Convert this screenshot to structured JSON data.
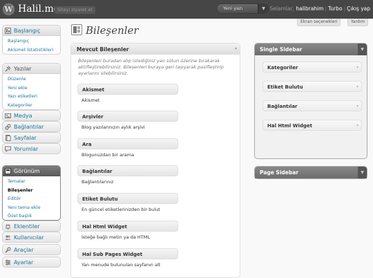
{
  "header": {
    "logo": "W",
    "site_title": "Halil.me",
    "visit_site": "Siteyi ziyaret et",
    "quick_action": "Yeni yazı",
    "greeting": "Selamlar,",
    "username": "halibrahim",
    "turbo": "Turbo",
    "logout": "Çıkış yap"
  },
  "screen_meta": {
    "screen_options": "Ekran seçenekleri",
    "help": "Yardım"
  },
  "menu": {
    "dashboard": {
      "label": "Başlangıç",
      "items": [
        "Başlangıç",
        "Akismet İstatistikleri"
      ]
    },
    "posts": {
      "label": "Yazılar",
      "items": [
        "Düzenle",
        "Yeni ekle",
        "Yazı etiketleri",
        "Kategoriler"
      ]
    },
    "media": "Medya",
    "links": "Bağlantılar",
    "pages": "Sayfalar",
    "comments": "Yorumlar",
    "appearance": {
      "label": "Görünüm",
      "items": [
        "Temalar",
        "Bileşenler",
        "Editör",
        "Yeni tema ekle",
        "Özel başlık"
      ]
    },
    "plugins": "Eklentiler",
    "users": "Kullanıcılar",
    "tools": "Araçlar",
    "settings": "Ayarlar"
  },
  "page_title": "Bileşenler",
  "available": {
    "title": "Mevcut Bileşenler",
    "description": "Bileşenleri buradan alıp istediğiniz yan sütun üzerine bırakarak aktifleştirebilirsiniz. Bileşenleri buraya geri taşıyarak pasifleştirip ayarlarını silebilirsiniz.",
    "widgets": [
      {
        "name": "Akismet",
        "desc": "Akismet"
      },
      {
        "name": "Arşivler",
        "desc": "Blog yazılarınızın aylık arşivi"
      },
      {
        "name": "Ara",
        "desc": "Blogunuzdan bir arama"
      },
      {
        "name": "Bağlantılar",
        "desc": "Bağlantılarınız"
      },
      {
        "name": "Etiket Bulutu",
        "desc": "En güncel etiketlerinizden bir bulut"
      },
      {
        "name": "Hal Html Widget",
        "desc": "İsteğe bağlı metin ya da HTML"
      },
      {
        "name": "Hal Sub Pages Widget",
        "desc": "Yan menude bulunulan sayfanın alt"
      }
    ]
  },
  "sidebars": [
    {
      "title": "Single Sidebar",
      "widgets": [
        "Kategoriler",
        "Etiket Bulutu",
        "Bağlantılar",
        "Hal Html Widget"
      ]
    },
    {
      "title": "Page Sidebar",
      "widgets": []
    }
  ],
  "icons": {
    "arrow_down": "▾",
    "arrow_down_small": "▼"
  }
}
